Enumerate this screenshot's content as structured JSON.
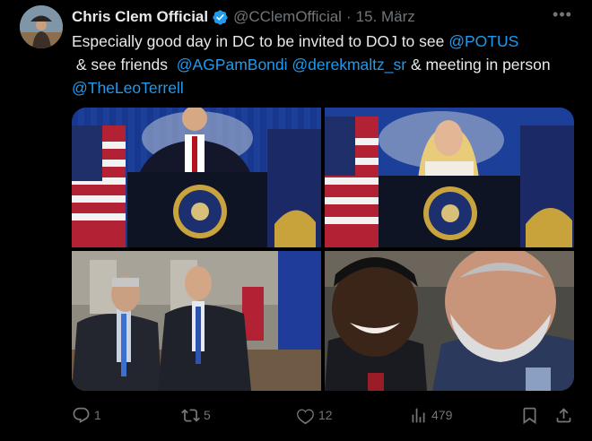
{
  "author": {
    "display_name": "Chris Clem Official",
    "handle": "@CClemOfficial",
    "separator": "·",
    "date": "15. März",
    "verified": true
  },
  "more_icon": "more-horizontal-icon",
  "tweet": {
    "segments": [
      {
        "text": "Especially good day in DC to be invited to DOJ to see ",
        "mention": false
      },
      {
        "text": "@POTUS",
        "mention": true
      },
      {
        "text": " & see friends  ",
        "mention": false
      },
      {
        "text": "@AGPamBondi",
        "mention": true
      },
      {
        "text": " ",
        "mention": false
      },
      {
        "text": "@derekmaltz_sr",
        "mention": true
      },
      {
        "text": " & meeting in person ",
        "mention": false
      },
      {
        "text": "@TheLeoTerrell",
        "mention": true
      }
    ]
  },
  "media": [
    {
      "icon": "photo-podium-potus"
    },
    {
      "icon": "photo-podium-speaker"
    },
    {
      "icon": "photo-two-men-hall"
    },
    {
      "icon": "photo-selfie"
    }
  ],
  "actions": {
    "reply": {
      "icon": "reply-icon",
      "count": "1"
    },
    "retweet": {
      "icon": "retweet-icon",
      "count": "5"
    },
    "like": {
      "icon": "heart-icon",
      "count": "12"
    },
    "views": {
      "icon": "views-icon",
      "count": "479"
    },
    "bookmark": {
      "icon": "bookmark-icon"
    },
    "share": {
      "icon": "share-icon"
    }
  },
  "colors": {
    "background": "#000000",
    "text": "#e7e9ea",
    "secondary": "#71767b",
    "accent": "#1d9bf0"
  }
}
